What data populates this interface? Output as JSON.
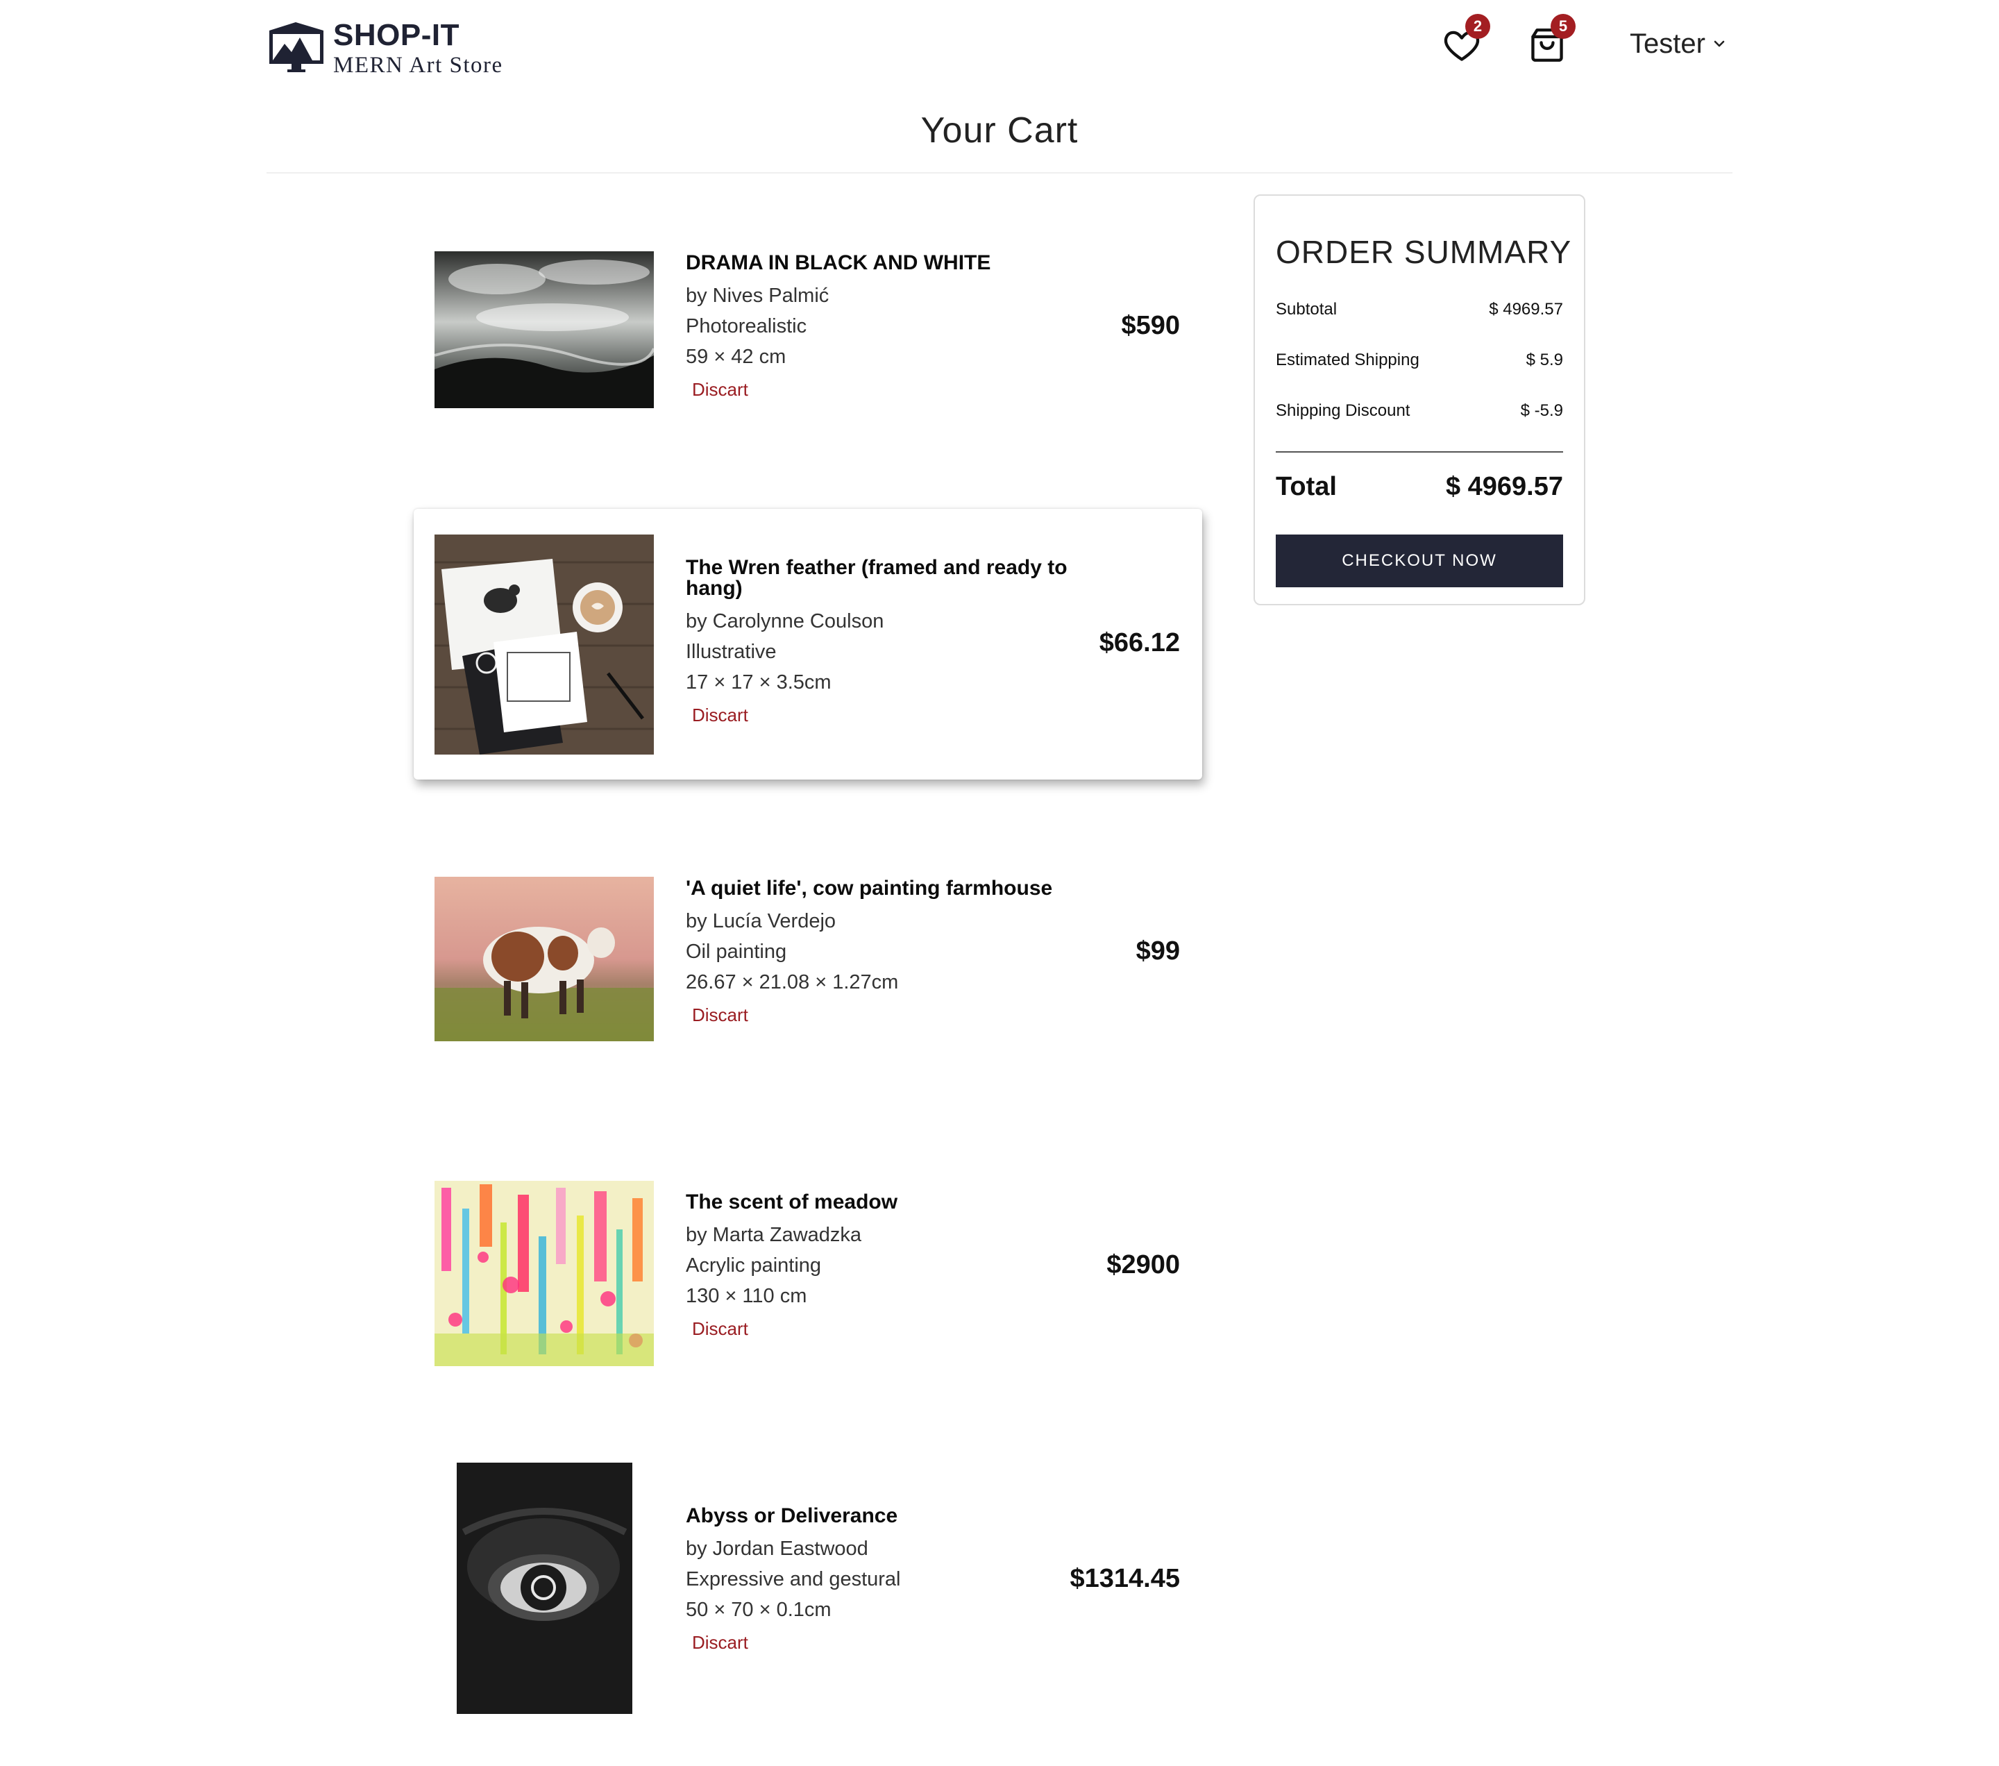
{
  "header": {
    "brand": "SHOP-IT",
    "subtitle": "MERN Art Store",
    "wishlist_count": "2",
    "cart_count": "5",
    "user_name": "Tester"
  },
  "page_title": "Your Cart",
  "items": [
    {
      "name": "DRAMA IN BLACK AND WHITE",
      "artist": "by Nives Palmić",
      "style": "Photorealistic",
      "size": "59 × 42 cm",
      "discard": "Discart",
      "price": "$590"
    },
    {
      "name": "The Wren feather (framed and ready to hang)",
      "artist": "by Carolynne Coulson",
      "style": "Illustrative",
      "size": "17 × 17 × 3.5cm",
      "discard": "Discart",
      "price": "$66.12"
    },
    {
      "name": "'A quiet life', cow painting farmhouse",
      "artist": "by Lucía Verdejo",
      "style": "Oil painting",
      "size": "26.67 × 21.08 × 1.27cm",
      "discard": "Discart",
      "price": "$99"
    },
    {
      "name": "The scent of meadow",
      "artist": "by Marta Zawadzka",
      "style": "Acrylic painting",
      "size": "130 × 110 cm",
      "discard": "Discart",
      "price": "$2900"
    },
    {
      "name": "Abyss or Deliverance",
      "artist": "by Jordan Eastwood",
      "style": "Expressive and gestural",
      "size": "50 × 70 × 0.1cm",
      "discard": "Discart",
      "price": "$1314.45"
    }
  ],
  "summary": {
    "title": "ORDER SUMMARY",
    "subtotal_label": "Subtotal",
    "subtotal_value": "$ 4969.57",
    "shipping_label": "Estimated Shipping",
    "shipping_value": "$ 5.9",
    "discount_label": "Shipping Discount",
    "discount_value": "$ -5.9",
    "total_label": "Total",
    "total_value": "$ 4969.57",
    "checkout_label": "CHECKOUT NOW"
  },
  "colors": {
    "accent_dark": "#232637",
    "badge_red": "#a31e22",
    "discard_red": "#9a1d22"
  }
}
